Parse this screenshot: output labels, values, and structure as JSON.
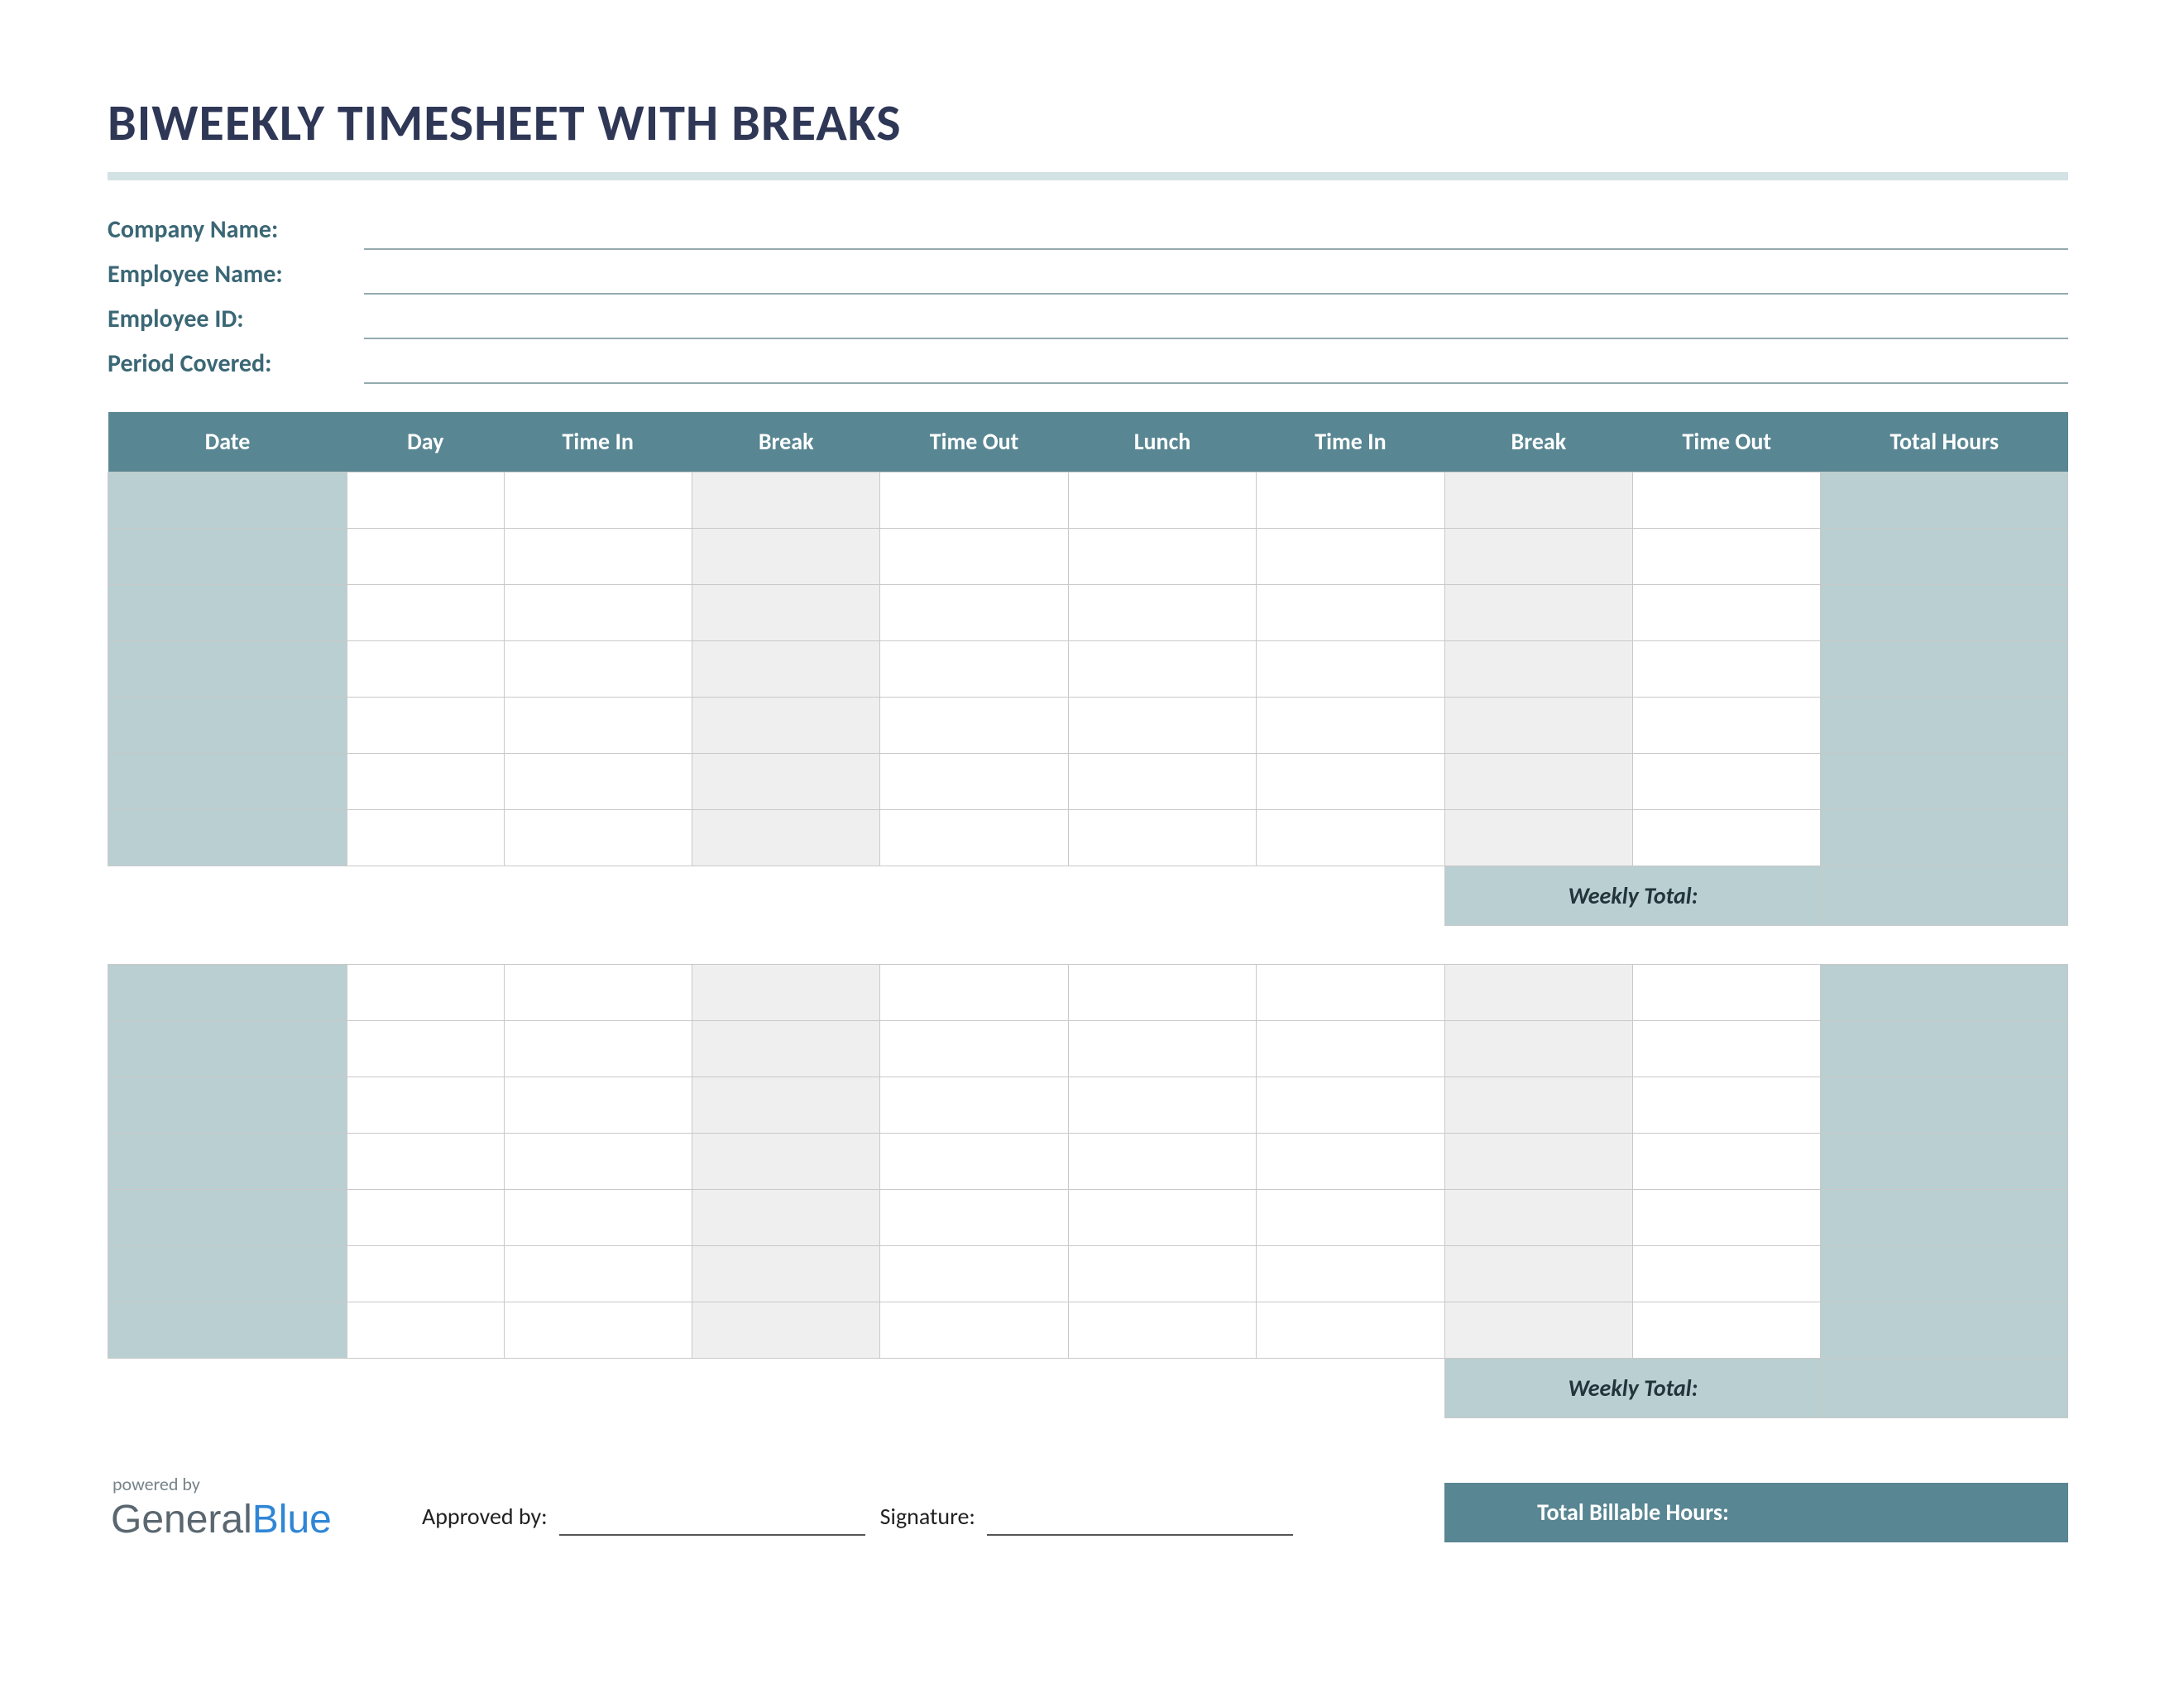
{
  "title": "BIWEEKLY TIMESHEET WITH BREAKS",
  "meta_labels": {
    "company": "Company Name:",
    "employee": "Employee Name:",
    "empid": "Employee ID:",
    "period": "Period Covered:"
  },
  "columns": [
    "Date",
    "Day",
    "Time In",
    "Break",
    "Time Out",
    "Lunch",
    "Time In",
    "Break",
    "Time Out",
    "Total Hours"
  ],
  "week1_rows": 7,
  "week2_rows": 7,
  "weekly_total_label": "Weekly Total:",
  "approved_label": "Approved by:",
  "signature_label": "Signature:",
  "total_billable_label": "Total Billable Hours:",
  "logo": {
    "powered": "powered by",
    "word1": "General",
    "word2": "Blue"
  },
  "colors": {
    "header_bg": "#588692",
    "shade": "#b9cfd1",
    "grey": "#efefef",
    "title": "#2f3756",
    "meta": "#3b6775"
  }
}
